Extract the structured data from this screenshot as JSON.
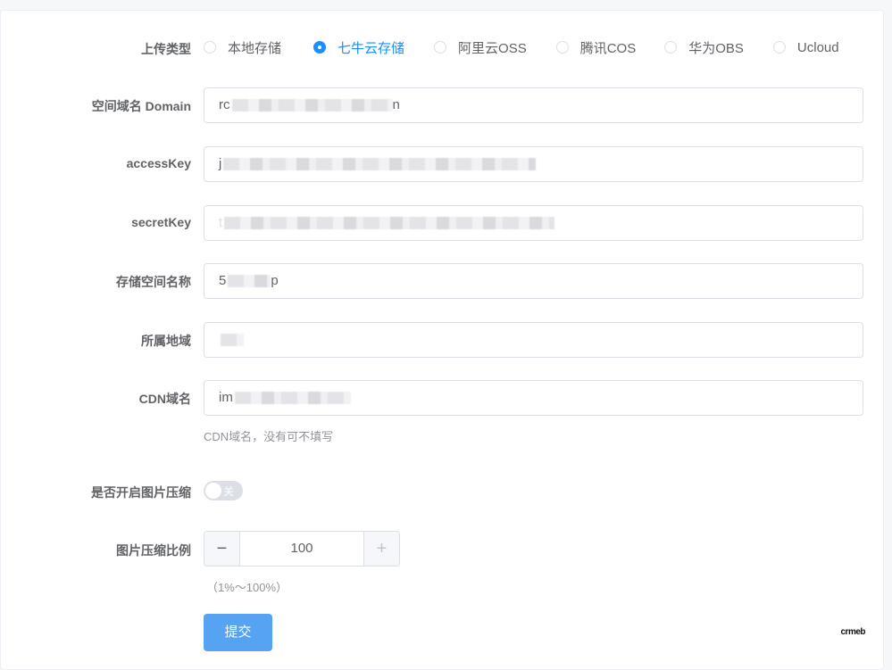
{
  "upload_type": {
    "label": "上传类型",
    "options": [
      {
        "label": "本地存储",
        "checked": false
      },
      {
        "label": "七牛云存储",
        "checked": true
      },
      {
        "label": "阿里云OSS",
        "checked": false
      },
      {
        "label": "腾讯COS",
        "checked": false
      },
      {
        "label": "华为OBS",
        "checked": false
      },
      {
        "label": "Ucloud",
        "checked": false
      }
    ]
  },
  "fields": {
    "domain": {
      "label": "空间域名 Domain",
      "value_prefix": "rc",
      "value_suffix": "n"
    },
    "access_key": {
      "label": "accessKey",
      "value_prefix": "j"
    },
    "secret_key": {
      "label": "secretKey",
      "value_prefix": "t"
    },
    "bucket": {
      "label": "存储空间名称",
      "value_prefix": "5",
      "value_suffix": "p"
    },
    "region": {
      "label": "所属地域",
      "value_prefix": ""
    },
    "cdn": {
      "label": "CDN域名",
      "value_prefix": "im",
      "hint": "CDN域名，没有可不填写"
    }
  },
  "compress": {
    "label": "是否开启图片压缩",
    "switch_text": "关",
    "enabled": false
  },
  "ratio": {
    "label": "图片压缩比例",
    "value": "100",
    "minus": "−",
    "plus": "+",
    "hint": "（1%～100%）"
  },
  "submit_label": "提交",
  "logo_text": "crmeb",
  "colors": {
    "primary": "#1890ff",
    "button": "#57a3f3"
  }
}
